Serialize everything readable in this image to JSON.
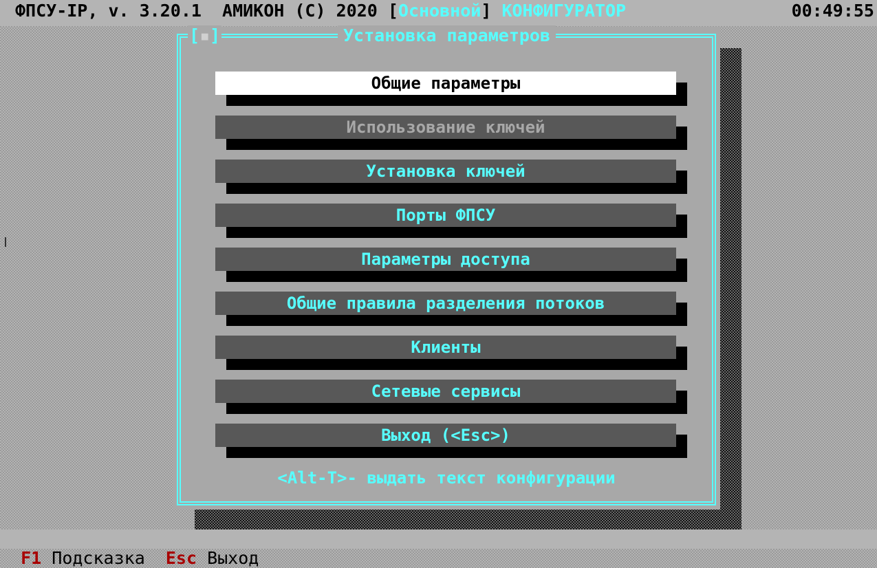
{
  "header": {
    "app": "ФПСУ-IP, v. 3.20.1  АМИКОН (C) 2020 [",
    "mode": "Основной",
    "sep": "]",
    "configurator": "КОНФИГУРАТОР",
    "clock": "00:49:55"
  },
  "dialog": {
    "close": "[",
    "close_box": "▪",
    "close_end": "]",
    "title": "Установка параметров"
  },
  "menu": {
    "items": [
      {
        "label": "Общие параметры",
        "state": "selected"
      },
      {
        "label": "Использование ключей",
        "state": "disabled"
      },
      {
        "label": "Установка ключей",
        "state": "normal"
      },
      {
        "label": "Порты ФПСУ",
        "state": "normal"
      },
      {
        "label": "Параметры доступа",
        "state": "normal"
      },
      {
        "label": "Общие правила разделения потоков",
        "state": "normal"
      },
      {
        "label": "Клиенты",
        "state": "normal"
      },
      {
        "label": "Сетевые сервисы",
        "state": "normal"
      },
      {
        "label": "Выход (<Esc>)",
        "state": "normal"
      }
    ]
  },
  "hint": "<Alt-T>- выдать текст конфигурации",
  "footer": {
    "f1_key": "F1",
    "f1_label": "Подсказка",
    "esc_key": "Esc",
    "esc_label": "Выход"
  },
  "colors": {
    "accent": "#57ffff",
    "key": "#a80000",
    "item_bg": "#585858",
    "selected_bg": "#ffffff",
    "dialog_bg": "#a8a8a8"
  }
}
